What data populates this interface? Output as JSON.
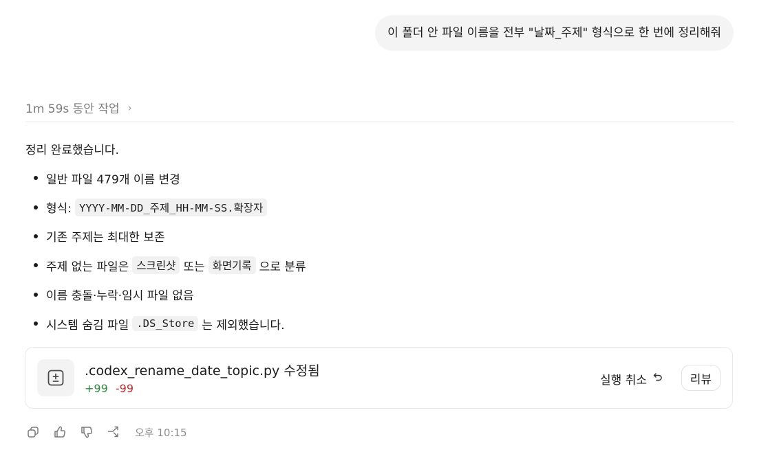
{
  "user_message": "이 폴더 안 파일 이름을 전부 \"날짜_주제\" 형식으로 한 번에 정리해줘",
  "work": {
    "label": "1m 59s 동안 작업",
    "chevron": "›"
  },
  "summary": "정리 완료했습니다.",
  "items": [
    {
      "text": "일반 파일 479개 이름 변경"
    },
    {
      "before": "형식: ",
      "code": "YYYY-MM-DD_주제_HH-MM-SS.확장자",
      "after": ""
    },
    {
      "text": "기존 주제는 최대한 보존"
    },
    {
      "before": "주제 없는 파일은 ",
      "code": "스크린샷",
      "middle": " 또는 ",
      "code2": "화면기록",
      "after": " 으로 분류"
    },
    {
      "text": "이름 충돌·누락·임시 파일 없음"
    },
    {
      "before": "시스템 숨김 파일 ",
      "code": ".DS_Store",
      "after": " 는 제외했습니다."
    }
  ],
  "file_card": {
    "icon": "diff-file-icon",
    "filename": ".codex_rename_date_topic.py 수정됨",
    "additions": "+99",
    "deletions": "-99",
    "undo_label": "실행 취소",
    "undo_icon": "undo-icon",
    "review_label": "리뷰"
  },
  "message_actions": {
    "icons": [
      "copy-icon",
      "thumbs-up-icon",
      "thumbs-down-icon",
      "fork-icon"
    ],
    "timestamp": "오후 10:15"
  },
  "colors": {
    "additions": "#2f8a3f",
    "deletions": "#c62a2a",
    "bubble": "#f4f4f4"
  }
}
